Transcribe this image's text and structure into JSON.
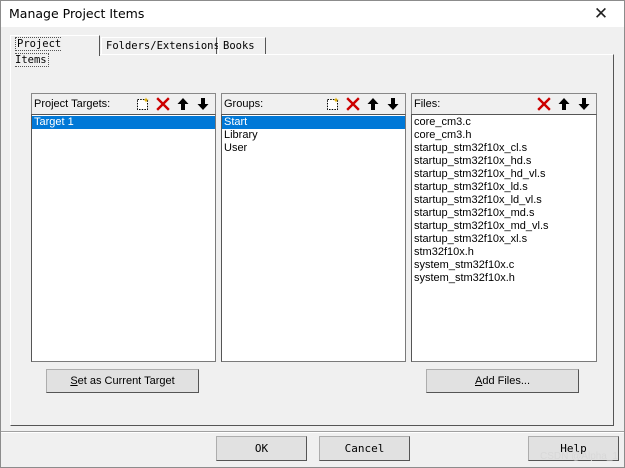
{
  "window": {
    "title": "Manage Project Items",
    "close_glyph": "✕"
  },
  "tabs": [
    {
      "label": "Project Items",
      "active": true
    },
    {
      "label": "Folders/Extensions",
      "active": false
    },
    {
      "label": "Books",
      "active": false
    }
  ],
  "targets": {
    "header": "Project Targets:",
    "items": [
      "Target 1"
    ],
    "selected_index": 0,
    "icons": [
      "new-icon",
      "delete-icon",
      "move-up-icon",
      "move-down-icon"
    ]
  },
  "groups": {
    "header": "Groups:",
    "items": [
      "Start",
      "Library",
      "User"
    ],
    "selected_index": 0,
    "icons": [
      "new-icon",
      "delete-icon",
      "move-up-icon",
      "move-down-icon"
    ]
  },
  "files": {
    "header": "Files:",
    "items": [
      "core_cm3.c",
      "core_cm3.h",
      "startup_stm32f10x_cl.s",
      "startup_stm32f10x_hd.s",
      "startup_stm32f10x_hd_vl.s",
      "startup_stm32f10x_ld.s",
      "startup_stm32f10x_ld_vl.s",
      "startup_stm32f10x_md.s",
      "startup_stm32f10x_md_vl.s",
      "startup_stm32f10x_xl.s",
      "stm32f10x.h",
      "system_stm32f10x.c",
      "system_stm32f10x.h"
    ],
    "icons": [
      "delete-icon",
      "move-up-icon",
      "move-down-icon"
    ]
  },
  "buttons": {
    "set_current_target": {
      "mnemonic": "S",
      "rest": "et as Current Target"
    },
    "add_files": {
      "mnemonic": "A",
      "rest": "dd Files..."
    },
    "ok": "OK",
    "cancel": "Cancel",
    "help": "Help"
  },
  "watermark": "CSDN @Alpha_1",
  "colors": {
    "selection": "#0078d7",
    "delete_red": "#cc0000",
    "dialog_bg": "#f0f0f0"
  }
}
